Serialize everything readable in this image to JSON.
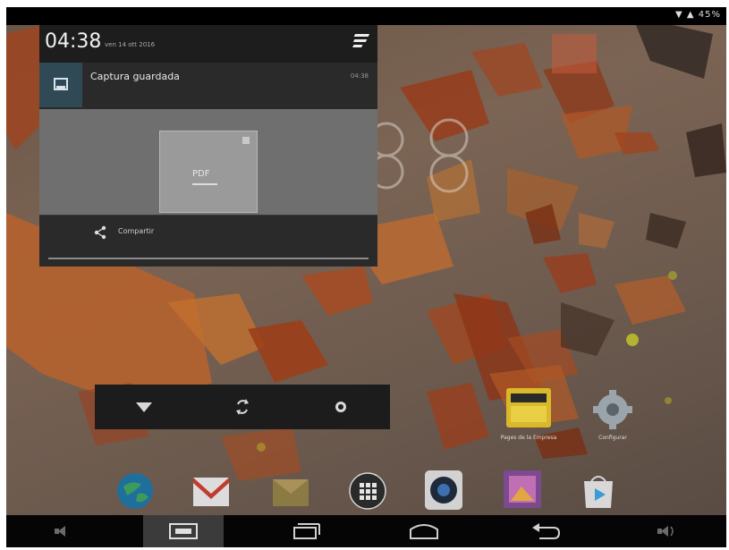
{
  "status_bar": {
    "icons_text": "▼ ▲ 45%"
  },
  "notification": {
    "time": "04:38",
    "date": "ven 14 ott 2016",
    "title": "Captura guardada",
    "time_small": "04:38",
    "preview_label": "PDF",
    "share_label": "Compartir"
  },
  "home_icons": [
    {
      "name": "pages-icon",
      "label": "Pages de la Empresa"
    },
    {
      "name": "settings-app-icon",
      "label": "Configurar"
    }
  ],
  "dock_icons": [
    "browser-icon",
    "gmail-icon",
    "email-icon",
    "apps-icon",
    "camera-icon",
    "gallery-icon",
    "play-store-icon"
  ],
  "nav_buttons": [
    "volume-down",
    "screenshot",
    "recent-apps",
    "home",
    "back",
    "volume-up"
  ],
  "colors": {
    "panel_bg": "#1d1d1d",
    "card_header": "#2f4955",
    "nav_bg": "#050505"
  }
}
